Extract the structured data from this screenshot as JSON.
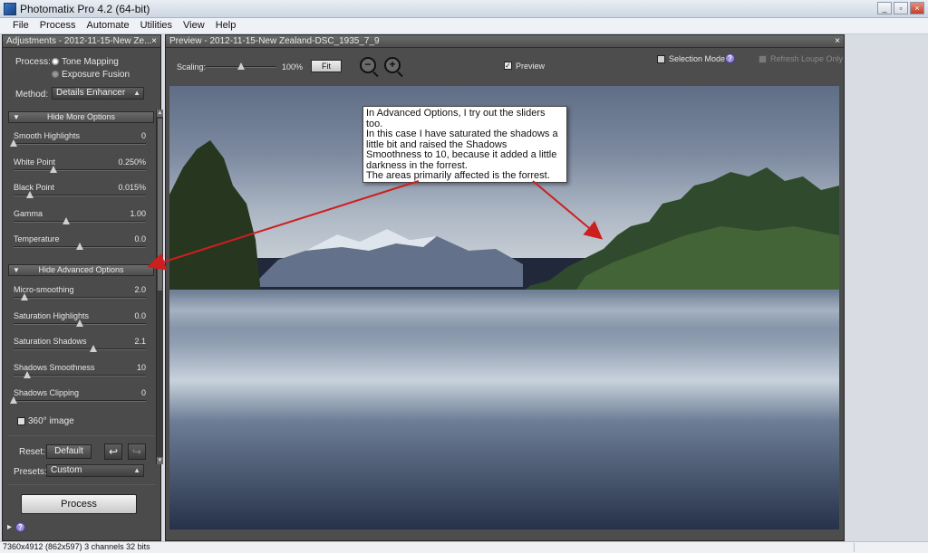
{
  "window": {
    "title": "Photomatix Pro 4.2 (64-bit)",
    "minimize_glyph": "_",
    "restore_glyph": "▫",
    "close_glyph": "×"
  },
  "menu": [
    "File",
    "Process",
    "Automate",
    "Utilities",
    "View",
    "Help"
  ],
  "adjustments": {
    "header": "Adjustments - 2012-11-15-New Ze...",
    "close_glyph": "×",
    "process_label": "Process:",
    "process_options": [
      "Tone Mapping",
      "Exposure Fusion"
    ],
    "process_selected": "Tone Mapping",
    "method_label": "Method:",
    "method_value": "Details Enhancer",
    "more_options_header": "Hide More Options",
    "more_sliders": [
      {
        "name": "Smooth Highlights",
        "value": "0",
        "fraction": 0.0
      },
      {
        "name": "White Point",
        "value": "0.250%",
        "fraction": 0.3
      },
      {
        "name": "Black Point",
        "value": "0.015%",
        "fraction": 0.12
      },
      {
        "name": "Gamma",
        "value": "1.00",
        "fraction": 0.4
      },
      {
        "name": "Temperature",
        "value": "0.0",
        "fraction": 0.5
      }
    ],
    "advanced_header": "Hide Advanced Options",
    "advanced_sliders": [
      {
        "name": "Micro-smoothing",
        "value": "2.0",
        "fraction": 0.08
      },
      {
        "name": "Saturation Highlights",
        "value": "0.0",
        "fraction": 0.5
      },
      {
        "name": "Saturation Shadows",
        "value": "2.1",
        "fraction": 0.6
      },
      {
        "name": "Shadows Smoothness",
        "value": "10",
        "fraction": 0.1
      },
      {
        "name": "Shadows Clipping",
        "value": "0",
        "fraction": 0.0
      }
    ],
    "image360_label": "360° image",
    "reset_label": "Reset:",
    "default_button": "Default",
    "undo_glyph": "↩",
    "redo_glyph": "↪",
    "presets_label": "Presets:",
    "presets_value": "Custom",
    "process_button": "Process",
    "footer_arrow": "▸",
    "help_glyph": "?"
  },
  "preview": {
    "header": "Preview - 2012-11-15-New Zealand-DSC_1935_7_9",
    "close_glyph": "×",
    "scaling_label": "Scaling:",
    "scaling_value": "100%",
    "scaling_fraction": 0.5,
    "fit_button": "Fit",
    "zoom_out_glyph": "−",
    "zoom_in_glyph": "+",
    "preview_label": "Preview",
    "preview_checked": true,
    "check_glyph": "✓",
    "selection_mode_label": "Selection Mode",
    "refresh_loupe_label": "Refresh Loupe Only",
    "help_glyph": "?"
  },
  "annotation": {
    "text": "In Advanced Options, I try out the sliders too.\nIn this case I have saturated the shadows a little bit and raised the Shadows Smoothness to 10, because it added a little darkness in the forrest.\nThe areas primarily affected is the forrest."
  },
  "status": {
    "text": "7360x4912 (862x597) 3 channels 32 bits"
  },
  "colors": {
    "panel_bg": "#4b4b4b",
    "arrow": "#cc1f1f",
    "annotation_bg": "#ffffff"
  }
}
